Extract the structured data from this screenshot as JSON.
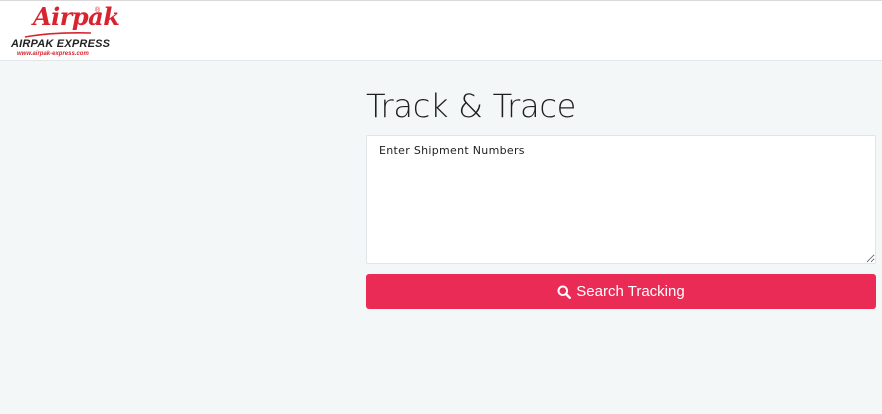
{
  "header": {
    "logo": {
      "script_text": "Airpak",
      "registered_mark": "®",
      "company_name": "AIRPAK EXPRESS",
      "website": "www.airpak-express.com"
    }
  },
  "main": {
    "title": "Track & Trace",
    "shipments_input": {
      "value": "",
      "placeholder": "Enter Shipment Numbers"
    },
    "search_button": {
      "label": "Search Tracking",
      "icon": "search-icon"
    }
  },
  "colors": {
    "page_background": "#f4f7f8",
    "header_background": "#ffffff",
    "accent": "#e92b55",
    "logo_red": "#d8242f"
  }
}
